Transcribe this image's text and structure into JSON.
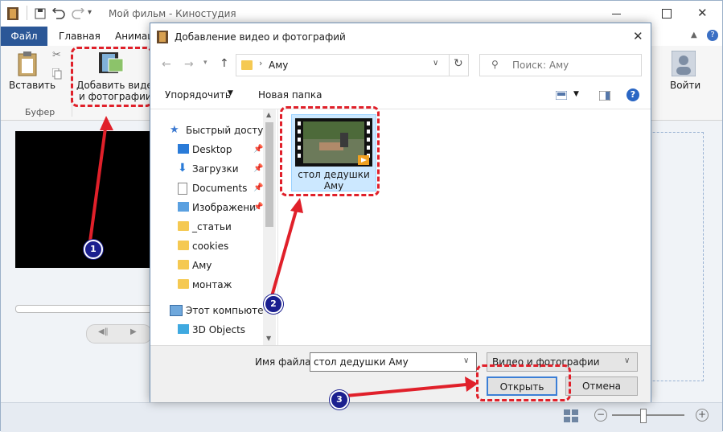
{
  "app": {
    "title": "Мой фильм - Киностудия",
    "tabs": [
      "Файл",
      "Главная",
      "Анимац"
    ],
    "ribbon": {
      "paste_label": "Вставить",
      "clipboard_group": "Буфер",
      "add_media_label_1": "Добавить видео",
      "add_media_label_2": "и фотографии",
      "signin_label": "Войти"
    }
  },
  "dialog": {
    "title": "Добавление видео и фотографий",
    "address": "Аму",
    "search_placeholder": "Поиск: Аму",
    "organize_label": "Упорядочить",
    "new_folder_label": "Новая папка",
    "nav": {
      "quick_access": "Быстрый доступ",
      "items": [
        "Desktop",
        "Загрузки",
        "Documents",
        "Изображени",
        "_статьи",
        "cookies",
        "Аму",
        "монтаж"
      ],
      "this_pc": "Этот компьютер",
      "objects3d": "3D Objects"
    },
    "file": {
      "name_line1": "стол дедушки",
      "name_line2": "Аму"
    },
    "filename_label": "Имя файла:",
    "filename_value": "стол дедушки Аму",
    "filter_value": "Видео и фотографии",
    "open_label": "Открыть",
    "cancel_label": "Отмена"
  },
  "annotations": {
    "badge1": "1",
    "badge2": "2",
    "badge3": "3",
    "accent_red": "#e0202a",
    "badge_color": "#1b1f8f"
  }
}
